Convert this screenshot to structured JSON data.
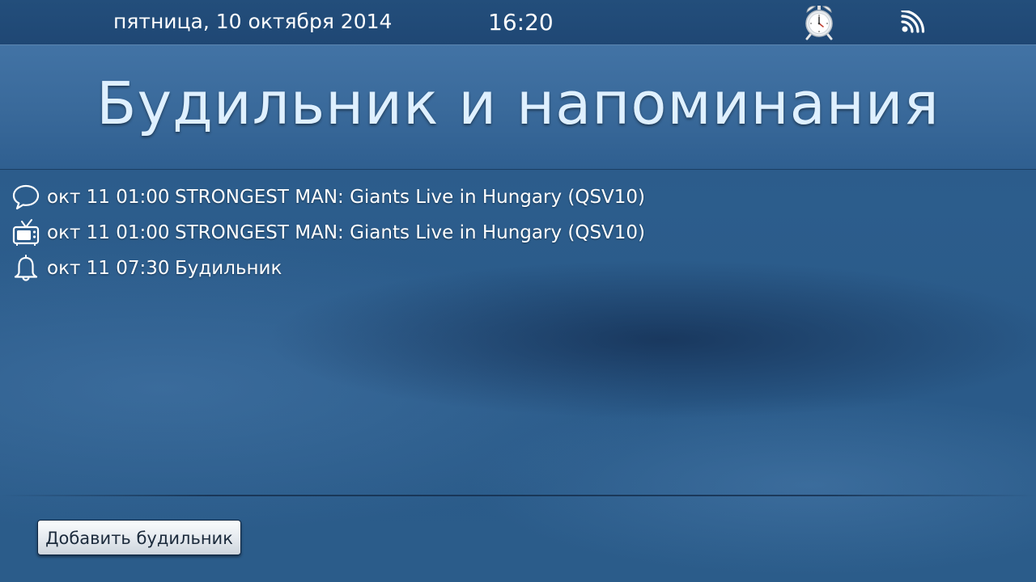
{
  "status_bar": {
    "date": "пятница, 10 октября 2014",
    "time": "16:20",
    "alarm_icon": "alarm-clock-icon",
    "rss_icon": "rss-feed-icon"
  },
  "header": {
    "title": "Будильник и напоминания"
  },
  "reminders": [
    {
      "icon": "chat-bubble-icon",
      "datetime": "окт 11 01:00",
      "text": "STRONGEST MAN: Giants Live in Hungary (QSV10)"
    },
    {
      "icon": "tv-icon",
      "datetime": "окт 11 01:00",
      "text": "STRONGEST MAN: Giants Live in Hungary (QSV10)"
    },
    {
      "icon": "bell-icon",
      "datetime": "окт 11 07:30",
      "text": "Будильник"
    }
  ],
  "footer": {
    "add_alarm_label": "Добавить будильник"
  },
  "colors": {
    "background": "#2b5b8a",
    "status_bar": "#214b77",
    "title_panel": "#3b6b9c",
    "title_text": "#dff0ff",
    "button_text": "#1c2b3c"
  }
}
